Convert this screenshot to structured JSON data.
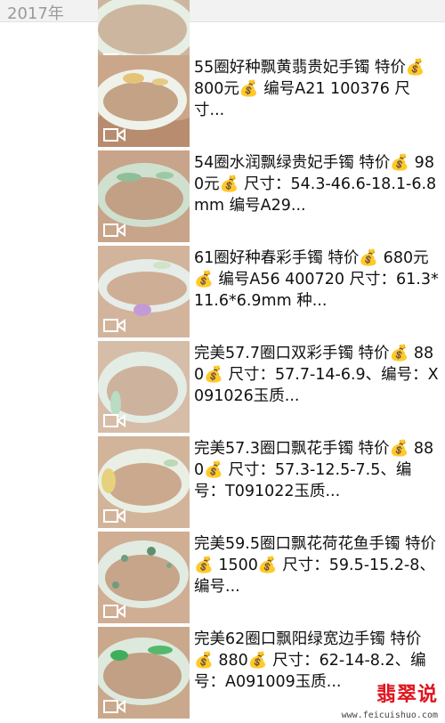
{
  "header": {
    "year": "2017年"
  },
  "posts": [
    {
      "caption": ""
    },
    {
      "caption": "55圈好种飘黄翡贵妃手镯 特价💰 800元💰 编号A21 100376 尺寸..."
    },
    {
      "caption": "54圈水润飘绿贵妃手镯 特价💰 980元💰 尺寸：54.3-46.6-18.1-6.8mm 编号A29..."
    },
    {
      "caption": "61圈好种春彩手镯 特价💰 680元💰 编号A56 400720 尺寸：61.3*11.6*6.9mm 种..."
    },
    {
      "caption": "完美57.7圈口双彩手镯 特价💰 880💰 尺寸：57.7-14-6.9、编号：X091026玉质..."
    },
    {
      "caption": "完美57.3圈口飘花手镯 特价💰 880💰 尺寸：57.3-12.5-7.5、编号：T091022玉质..."
    },
    {
      "caption": "完美59.5圈口飘花荷花鱼手镯 特价💰 1500💰 尺寸：59.5-15.2-8、编号..."
    },
    {
      "caption": "完美62圈口飘阳绿宽边手镯 特价💰 880💰 尺寸：62-14-8.2、编号：A091009玉质..."
    }
  ],
  "watermark": {
    "title": "翡翠说",
    "url": "www.feicuishuo.com"
  },
  "colors": {
    "jade": "#e8efe6",
    "skin": "#d9b79c",
    "watermark": "#e0141e"
  }
}
